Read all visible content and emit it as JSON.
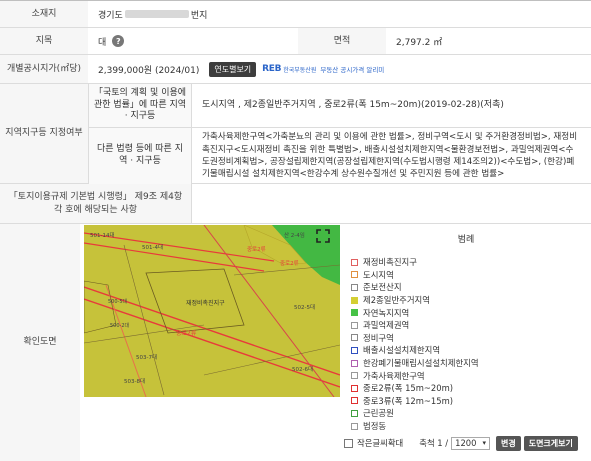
{
  "location": {
    "label": "소재지",
    "prefix": "경기도",
    "suffix": "번지"
  },
  "land_category": {
    "label": "지목",
    "value": "대",
    "help_icon": "question-circle-icon"
  },
  "area": {
    "label": "면적",
    "value": "2,797.2 ㎡"
  },
  "official_price": {
    "label": "개별공시지가(㎡당)",
    "value": "2,399,000원 (2024/01)",
    "button": "연도별보기",
    "reb_logo": "REB",
    "reb_name": "한국부동산원",
    "reb_link": "부동산 공시가격 알리미"
  },
  "zoning": {
    "label": "지역지구등 지정여부",
    "row1_label": "「국토의 계획 및 이용에 관한 법률」에 따른 지역 · 지구등",
    "row1_value": "도시지역 , 제2종일반주거지역 , 중로2류(폭 15m~20m)(2019-02-28)(저촉)",
    "row2_label": "다른 법령 등에 따른 지역 · 지구등",
    "row2_value": "가축사육제한구역<가축분뇨의 관리 및 이용에 관한 법률>, 정비구역<도시 및 주거환경정비법>, 재정비촉진지구<도시재정비 촉진을 위한 특별법>, 배출시설설치제한지역<물환경보전법>, 과밀억제권역<수도권정비계획법>, 공장설립제한지역(공장설립제한지역(수도법시행령 제14조의2))<수도법>, (한강)폐기물매립시설 설치제한지역<한강수계 상수원수질개선 및 주민지원 등에 관한 법률>"
  },
  "enforcement": {
    "label": "「토지이용규제 기본법 시행령」 제9조 제4항 각 호에 해당되는 사항",
    "value": ""
  },
  "map_section": {
    "label": "확인도면"
  },
  "map": {
    "texts": [
      "501-14대",
      "501-4대",
      "재정비촉진지구",
      "중로2류",
      "502-5대",
      "502-6대",
      "503-7대",
      "503-8대",
      "중로2류",
      "산 2-4임",
      "500-5대",
      "500-2대",
      "중로2류"
    ],
    "expand_icon": "expand-icon"
  },
  "legend": {
    "title": "범례",
    "items": [
      {
        "label": "재정비촉진지구",
        "color": "#ffffff",
        "border": "#e06060"
      },
      {
        "label": "도시지역",
        "color": "#ffffff",
        "border": "#e09040"
      },
      {
        "label": "준보전산지",
        "color": "#ffffff",
        "border": "#888888"
      },
      {
        "label": "제2종일반주거지역",
        "color": "#d4cf34",
        "border": "#d4cf34"
      },
      {
        "label": "자연녹지지역",
        "color": "#46c246",
        "border": "#46c246"
      },
      {
        "label": "과밀억제권역",
        "color": "#ffffff",
        "border": "#999999"
      },
      {
        "label": "정비구역",
        "color": "#ffffff",
        "border": "#888888"
      },
      {
        "label": "배출시설설치제한지역",
        "color": "#ffffff",
        "border": "#3050c0"
      },
      {
        "label": "한강폐기물매립시설설치제한지역",
        "color": "#ffffff",
        "border": "#b060b0"
      },
      {
        "label": "가축사육제한구역",
        "color": "#ffffff",
        "border": "#999999"
      },
      {
        "label": "중로2류(폭 15m~20m)",
        "color": "#ffffff",
        "border": "#e03030"
      },
      {
        "label": "중로3류(폭 12m~15m)",
        "color": "#ffffff",
        "border": "#e03030"
      },
      {
        "label": "근린공원",
        "color": "#ffffff",
        "border": "#40a040"
      },
      {
        "label": "법정동",
        "color": "#ffffff",
        "border": "#999999"
      }
    ]
  },
  "controls": {
    "small_text_label": "작은글씨확대",
    "scale_label": "축척 1 /",
    "scale_value": "1200",
    "change_button": "변경",
    "map_button": "도면크게보기"
  }
}
